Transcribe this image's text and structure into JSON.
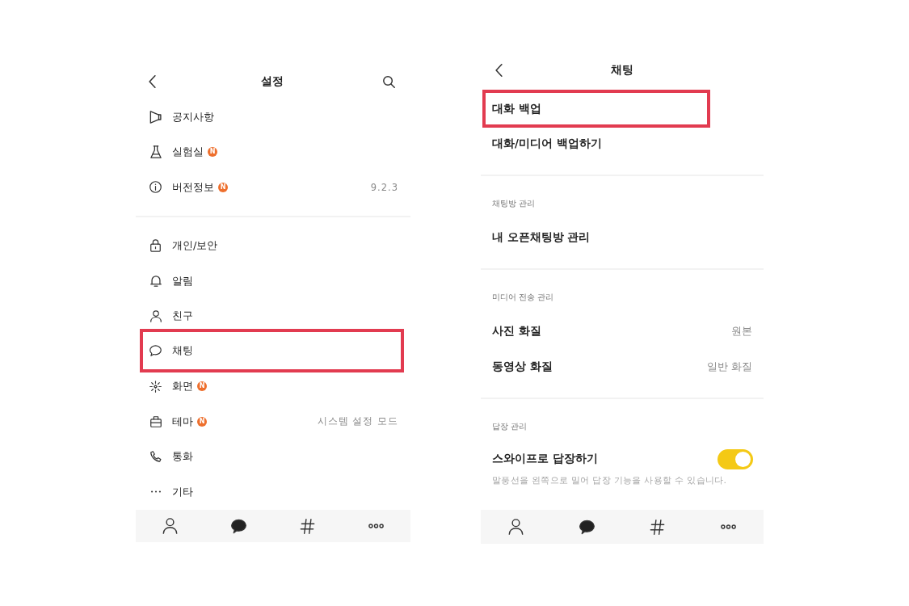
{
  "settings_screen": {
    "header": {
      "title": "설정"
    },
    "groups": [
      {
        "items": [
          {
            "label": "공지사항",
            "highlighted": false
          },
          {
            "label": "실험실",
            "badge": "N",
            "highlighted": false
          },
          {
            "label": "버전정보",
            "badge": "N",
            "value": "9.2.3",
            "highlighted": false
          }
        ]
      },
      {
        "items": [
          {
            "label": "개인/보안",
            "highlighted": false
          },
          {
            "label": "알림",
            "highlighted": false
          },
          {
            "label": "친구",
            "highlighted": false
          },
          {
            "label": "채팅",
            "highlighted": true
          },
          {
            "label": "화면",
            "badge": "N",
            "highlighted": false
          },
          {
            "label": "테마",
            "badge": "N",
            "value": "시스템 설정 모드",
            "highlighted": false
          },
          {
            "label": "통화",
            "highlighted": false
          },
          {
            "label": "기타",
            "highlighted": false
          }
        ]
      }
    ],
    "tab_bar": [
      {
        "selected": false
      },
      {
        "selected": true
      },
      {
        "selected": false
      },
      {
        "selected": false
      }
    ]
  },
  "chat_settings_screen": {
    "header": {
      "title": "채팅"
    },
    "sections": [
      {
        "items": [
          {
            "kind": "link",
            "label": "대화 백업",
            "highlighted": true
          },
          {
            "kind": "link",
            "label": "대화/미디어 백업하기",
            "highlighted": false
          }
        ]
      },
      {
        "heading": "채팅방 관리",
        "items": [
          {
            "kind": "link",
            "label": "내 오픈채팅방 관리",
            "highlighted": false
          }
        ]
      },
      {
        "heading": "미디어 전송 관리",
        "items": [
          {
            "kind": "link",
            "label": "사진 화질",
            "value": "원본",
            "highlighted": false
          },
          {
            "kind": "link",
            "label": "동영상 화질",
            "value": "일반 화질",
            "highlighted": false
          }
        ]
      },
      {
        "heading": "답장 관리",
        "items": [
          {
            "kind": "toggle",
            "label": "스와이프로 답장하기",
            "description": "말풍선을 왼쪽으로 밀어 답장 기능을 사용할 수 있습니다.",
            "on": true,
            "highlighted": false
          }
        ]
      }
    ],
    "tab_bar": [
      {
        "selected": false
      },
      {
        "selected": true
      },
      {
        "selected": false
      },
      {
        "selected": false
      }
    ]
  }
}
